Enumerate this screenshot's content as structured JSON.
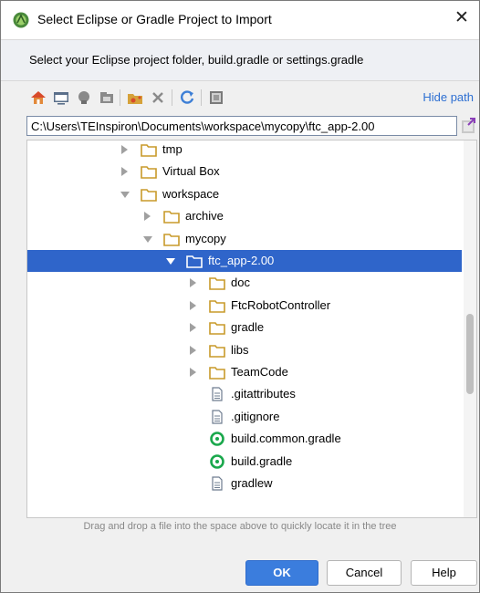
{
  "window": {
    "title": "Select Eclipse or Gradle Project to Import",
    "close_glyph": "✕",
    "app_icon": "android-studio-icon"
  },
  "instruction": "Select your Eclipse project folder, build.gradle or settings.gradle",
  "toolbar": {
    "buttons": [
      "home-icon",
      "desktop-icon",
      "project-icon",
      "module-icon",
      "new-folder-icon",
      "delete-icon",
      "refresh-icon",
      "show-hidden-icon"
    ],
    "hide_path_label": "Hide path"
  },
  "path": {
    "value": "C:\\Users\\TEInspiron\\Documents\\workspace\\mycopy\\ftc_app-2.00"
  },
  "tree": {
    "items": [
      {
        "label": "tmp",
        "type": "folder",
        "expand": "collapsed",
        "level": 0
      },
      {
        "label": "Virtual Box",
        "type": "folder",
        "expand": "collapsed",
        "level": 0
      },
      {
        "label": "workspace",
        "type": "folder",
        "expand": "expanded",
        "level": 0
      },
      {
        "label": "archive",
        "type": "folder",
        "expand": "collapsed",
        "level": 1
      },
      {
        "label": "mycopy",
        "type": "folder",
        "expand": "expanded",
        "level": 1
      },
      {
        "label": "ftc_app-2.00",
        "type": "folder",
        "expand": "expanded",
        "level": 2,
        "selected": true
      },
      {
        "label": "doc",
        "type": "folder",
        "expand": "collapsed",
        "level": 3
      },
      {
        "label": "FtcRobotController",
        "type": "folder",
        "expand": "collapsed",
        "level": 3
      },
      {
        "label": "gradle",
        "type": "folder",
        "expand": "collapsed",
        "level": 3
      },
      {
        "label": "libs",
        "type": "folder",
        "expand": "collapsed",
        "level": 3
      },
      {
        "label": "TeamCode",
        "type": "folder",
        "expand": "collapsed",
        "level": 3
      },
      {
        "label": ".gitattributes",
        "type": "file",
        "expand": "none",
        "level": 3
      },
      {
        "label": ".gitignore",
        "type": "file",
        "expand": "none",
        "level": 3
      },
      {
        "label": "build.common.gradle",
        "type": "gradle",
        "expand": "none",
        "level": 3
      },
      {
        "label": "build.gradle",
        "type": "gradle",
        "expand": "none",
        "level": 3
      },
      {
        "label": "gradlew",
        "type": "file",
        "expand": "none",
        "level": 3
      }
    ]
  },
  "hint": "Drag and drop a file into the space above to quickly locate it in the tree",
  "buttons": {
    "ok": "OK",
    "cancel": "Cancel",
    "help": "Help"
  },
  "colors": {
    "selection": "#2f65ca",
    "folder": "#c89a2a",
    "gradle": "#1aa84c",
    "link": "#2d6fd2",
    "ok_button": "#3b7ddd"
  }
}
